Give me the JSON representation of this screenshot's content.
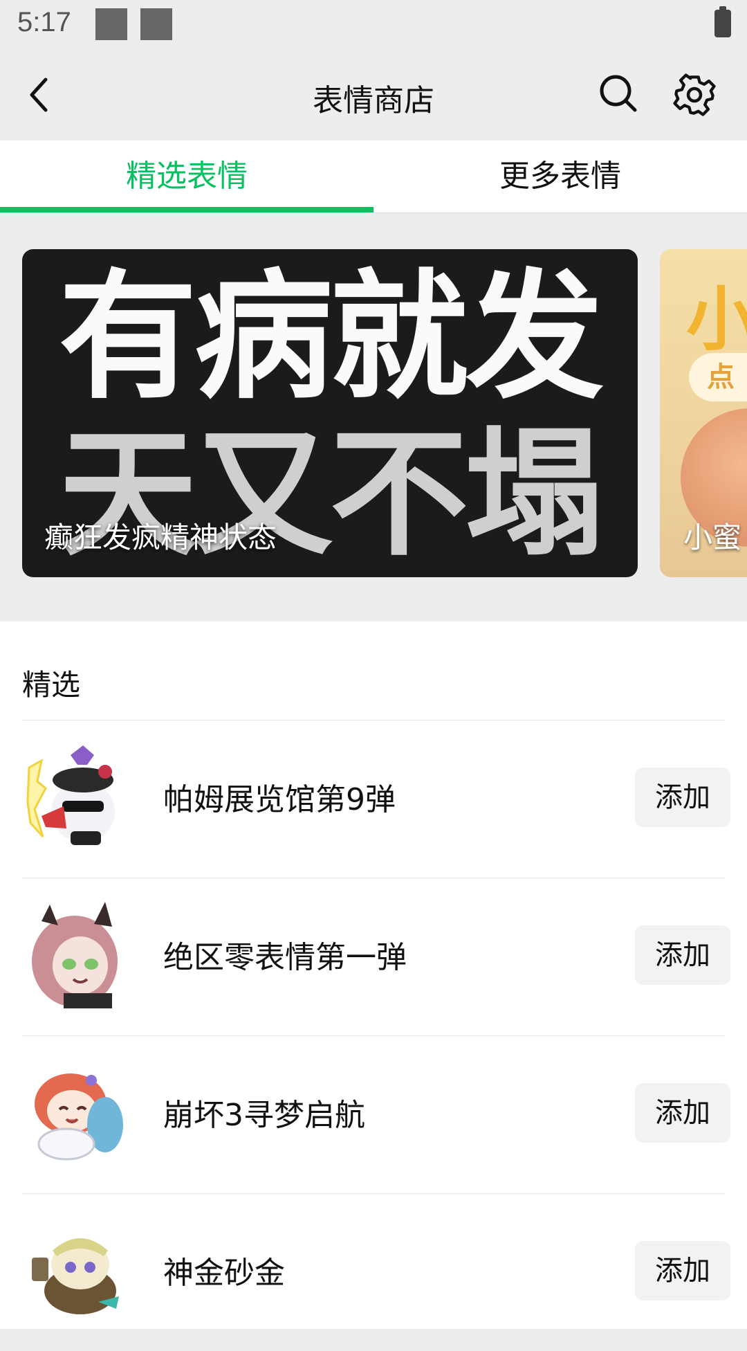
{
  "status": {
    "time": "5:17"
  },
  "header": {
    "title": "表情商店"
  },
  "tabs": [
    {
      "label": "精选表情",
      "active": true
    },
    {
      "label": "更多表情",
      "active": false
    }
  ],
  "banners": [
    {
      "lines": [
        "有病就发",
        "天又不塌"
      ],
      "caption": "癫狂发疯精神状态"
    },
    {
      "big": "小",
      "pill": "点",
      "caption": "小蜜"
    }
  ],
  "section": {
    "title": "精选"
  },
  "items": [
    {
      "name": "帕姆展览馆第9弹",
      "button": "添加",
      "icon": "pam-sticker-icon"
    },
    {
      "name": "绝区零表情第一弹",
      "button": "添加",
      "icon": "zzz-sticker-icon"
    },
    {
      "name": "崩坏3寻梦启航",
      "button": "添加",
      "icon": "honkai3-sticker-icon"
    },
    {
      "name": "神金砂金",
      "button": "添加",
      "icon": "aventurine-sticker-icon"
    }
  ],
  "colors": {
    "accent": "#07c160",
    "background": "#ededed"
  }
}
